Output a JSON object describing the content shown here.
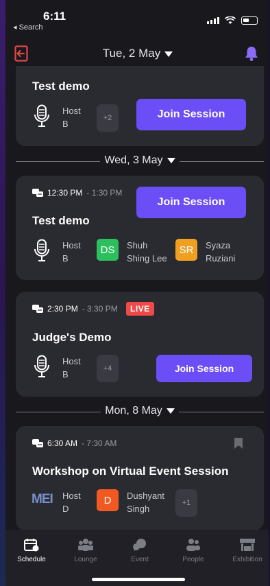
{
  "statusbar": {
    "time": "6:11",
    "back_label": "◂ Search"
  },
  "header": {
    "date": "Tue, 2 May"
  },
  "cards": {
    "c0": {
      "title": "Test demo",
      "host": [
        "Host",
        "B"
      ],
      "more": "+2",
      "join": "Join Session"
    },
    "c1": {
      "time_start": "12:30 PM",
      "time_end": "- 1:30 PM",
      "join": "Join Session",
      "title": "Test demo",
      "host": [
        "Host",
        "B"
      ],
      "sp1_initials": "DS",
      "sp1_name": [
        "Shuh",
        "Shing Lee"
      ],
      "sp1_color": "#2bbf5e",
      "sp2_initials": "SR",
      "sp2_name": [
        "Syaza",
        "Ruziani"
      ],
      "sp2_color": "#f0a020"
    },
    "c2": {
      "time_start": "2:30 PM",
      "time_end": "- 3:30 PM",
      "live": "LIVE",
      "title": "Judge's Demo",
      "host": [
        "Host",
        "B"
      ],
      "more": "+4",
      "join": "Join Session"
    },
    "c3": {
      "time_start": "6:30 AM",
      "time_end": "- 7:30 AM",
      "title": "Workshop on Virtual Event Session",
      "logo_text": "MEI",
      "host": [
        "Host",
        "D"
      ],
      "sp1_initials": "D",
      "sp1_name": [
        "Dushyant",
        "Singh"
      ],
      "sp1_color": "#f05a22",
      "more": "+1"
    }
  },
  "dividers": {
    "d1": "Wed, 3 May",
    "d2": "Mon, 8 May"
  },
  "nav": {
    "schedule": "Schedule",
    "lounge": "Lounge",
    "event": "Event",
    "people": "People",
    "exhibition": "Exhibition"
  },
  "colors": {
    "accent": "#6b4ef6",
    "live": "#ee4a4a",
    "exit": "#e24747",
    "bell": "#8b6cf6"
  }
}
